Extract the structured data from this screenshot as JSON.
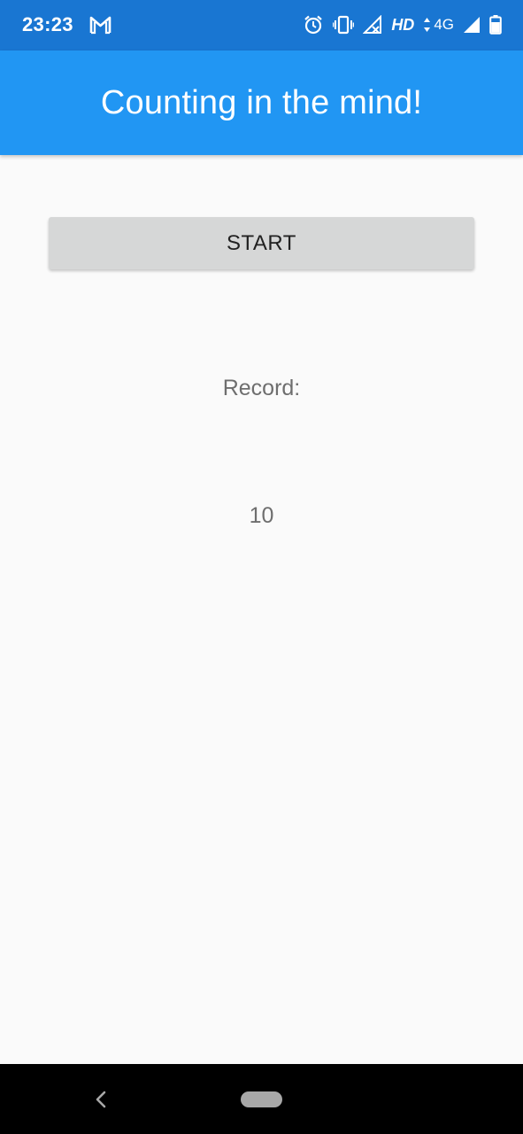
{
  "status_bar": {
    "time": "23:23",
    "network_label": "HD",
    "network_type": "4G",
    "icons": [
      "gmail-icon",
      "alarm-icon",
      "vibrate-icon",
      "signal-off-icon",
      "data-arrows-icon",
      "signal-icon",
      "battery-icon"
    ]
  },
  "app_bar": {
    "title": "Counting in the mind!"
  },
  "main": {
    "start_label": "START",
    "record_label": "Record:",
    "record_value": "10"
  },
  "nav_bar": {
    "icons": [
      "back-icon",
      "home-pill-icon"
    ]
  },
  "colors": {
    "status_bar": "#1976D2",
    "app_bar": "#2196F3",
    "background": "#FAFAFA",
    "button": "#D6D7D7",
    "secondary_text": "#6E6E6E",
    "nav_bar": "#000000"
  }
}
